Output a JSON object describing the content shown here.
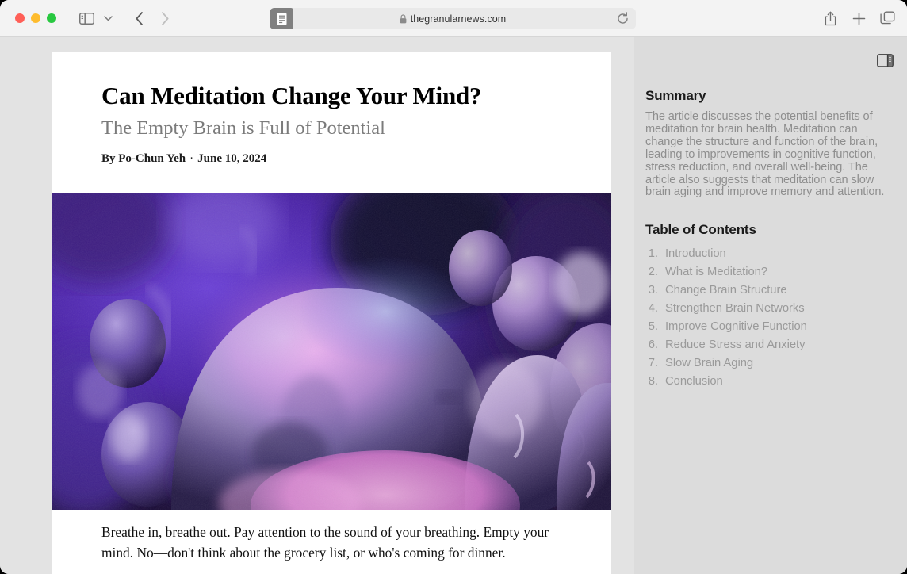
{
  "browser": {
    "window_controls": [
      {
        "name": "close",
        "color": "#ff5f57"
      },
      {
        "name": "minimize",
        "color": "#febc2e"
      },
      {
        "name": "maximize",
        "color": "#28c840"
      }
    ],
    "toolbar": {
      "sidebar_toggle": "sidebar-icon",
      "sidebar_dropdown": "chevron-down-icon",
      "back": "chevron-left-icon",
      "forward": "chevron-right-icon",
      "reader_mode": "reader-icon",
      "lock": "lock-icon",
      "url": "thegranularnews.com",
      "reload": "reload-icon",
      "share": "share-icon",
      "new_tab": "plus-icon",
      "tab_overview": "tabs-icon"
    }
  },
  "article": {
    "title": "Can Meditation Change Your Mind?",
    "subtitle": "The Empty Brain is Full of Potential",
    "author": "By Po-Chun Yeh",
    "separator": "·",
    "date": "June 10, 2024",
    "hero_alt": "abstract-purple-heads-illustration",
    "body": "Breathe in, breathe out. Pay attention to the sound of your breathing. Empty your mind. No—don't think about the grocery list, or who's coming for dinner."
  },
  "panel": {
    "toggle_icon": "sidebar-right-icon",
    "summary_heading": "Summary",
    "summary_text": "The article discusses the potential benefits of meditation for brain health. Meditation can change the structure and function of the brain, leading to improvements in cognitive function, stress reduction, and overall well-being. The article also suggests that meditation can slow brain aging and improve memory and attention.",
    "toc_heading": "Table of Contents",
    "toc": [
      {
        "num": "1.",
        "label": "Introduction"
      },
      {
        "num": "2.",
        "label": "What is Meditation?"
      },
      {
        "num": "3.",
        "label": "Change Brain Structure"
      },
      {
        "num": "4.",
        "label": "Strengthen Brain Networks"
      },
      {
        "num": "5.",
        "label": "Improve Cognitive Function"
      },
      {
        "num": "6.",
        "label": "Reduce Stress and Anxiety"
      },
      {
        "num": "7.",
        "label": "Slow Brain Aging"
      },
      {
        "num": "8.",
        "label": "Conclusion"
      }
    ]
  },
  "theme": {
    "page_bg": "#e3e3e3",
    "toolbar_bg": "#f3f3f3",
    "panel_bg": "#dcdcdc",
    "card_bg": "#ffffff",
    "muted_text": "#9a9a9a"
  }
}
